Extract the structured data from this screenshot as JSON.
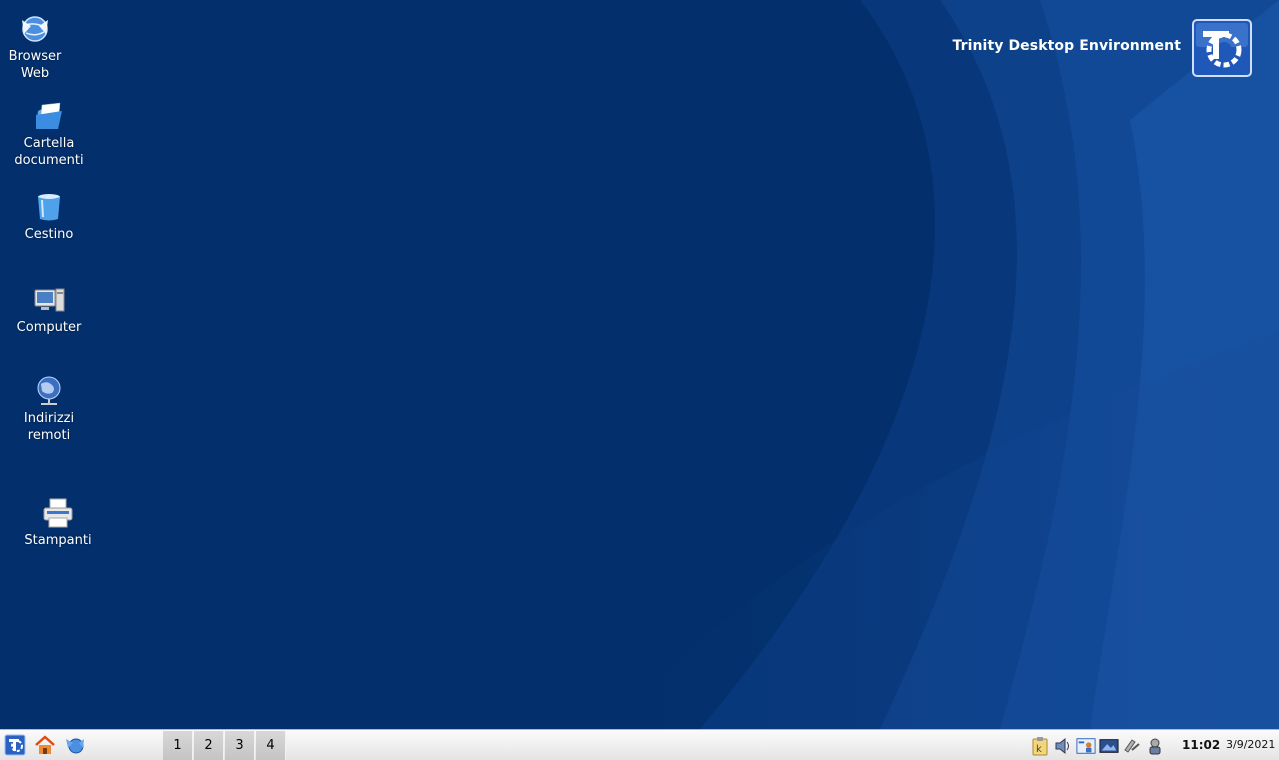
{
  "desktop": {
    "icons": [
      {
        "label": "Browser\nWeb",
        "icon": "globe-browser-icon"
      },
      {
        "label": "Cartella\ndocumenti",
        "icon": "folder-icon"
      },
      {
        "label": "Cestino",
        "icon": "trash-icon"
      },
      {
        "label": "Computer",
        "icon": "computer-icon"
      },
      {
        "label": "Indirizzi\nremoti",
        "icon": "network-globe-icon"
      },
      {
        "label": "Stampanti",
        "icon": "printer-icon"
      }
    ],
    "brand": {
      "text": "Trinity Desktop Environment",
      "logo": "trinity-logo-icon"
    },
    "colors": {
      "background": "#03306c",
      "accent": "#1d4fa3"
    }
  },
  "taskbar": {
    "launchers": [
      {
        "name": "tde-menu-icon"
      },
      {
        "name": "home-icon"
      },
      {
        "name": "browser-icon"
      }
    ],
    "pager": [
      "1",
      "2",
      "3",
      "4"
    ],
    "tray": [
      {
        "name": "klipper-icon"
      },
      {
        "name": "volume-icon"
      },
      {
        "name": "user-switch-icon"
      },
      {
        "name": "display-icon"
      },
      {
        "name": "network-icon"
      },
      {
        "name": "updates-icon"
      }
    ],
    "clock": {
      "time": "11:02",
      "date": "3/9/2021"
    }
  }
}
